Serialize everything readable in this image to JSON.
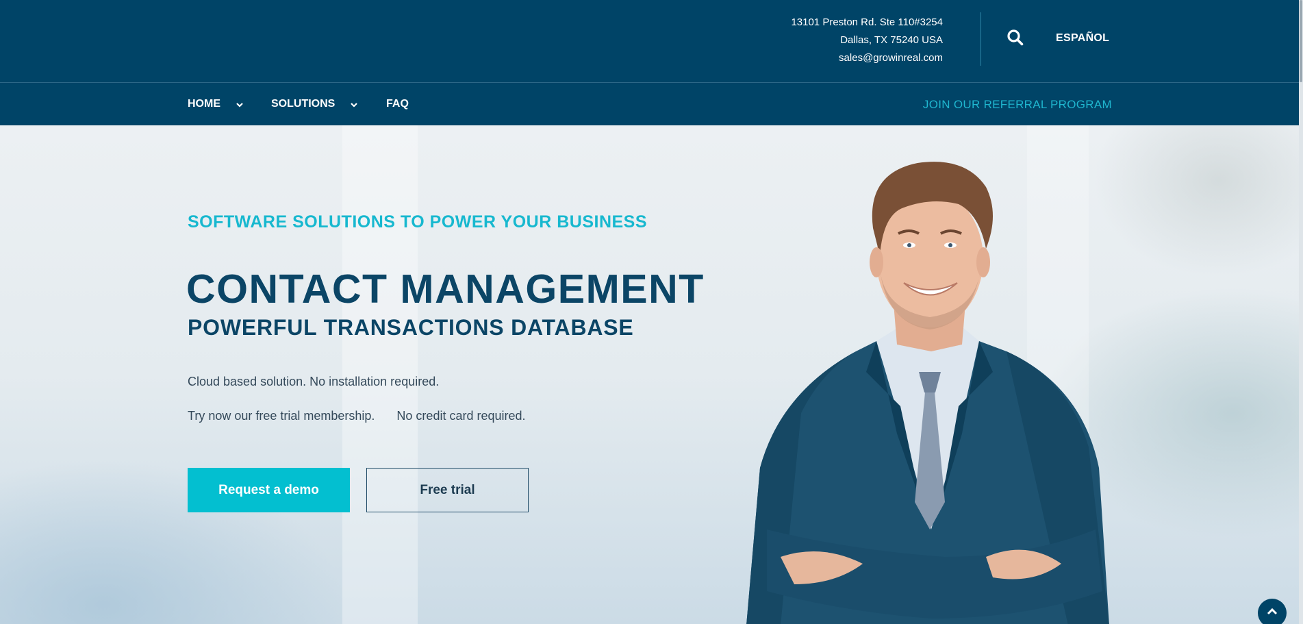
{
  "header": {
    "address_line1": "13101 Preston Rd. Ste 110#3254",
    "address_line2": "Dallas, TX 75240 USA",
    "email": "sales@growinreal.com",
    "search_icon": "search-icon",
    "language_label": "ESPAÑOL"
  },
  "nav": {
    "items": [
      {
        "label": "HOME",
        "has_dropdown": true
      },
      {
        "label": "SOLUTIONS",
        "has_dropdown": true
      },
      {
        "label": "FAQ",
        "has_dropdown": false
      }
    ],
    "referral_label": "JOIN OUR REFERRAL PROGRAM"
  },
  "hero": {
    "tagline": "SOFTWARE SOLUTIONS TO POWER YOUR BUSINESS",
    "headline": "CONTACT MANAGEMENT",
    "subheadline": "POWERFUL TRANSACTIONS DATABASE",
    "line1": "Cloud based solution. No installation required.",
    "line2_part1": "Try now our free trial membership.",
    "line2_part2": "No credit card required.",
    "demo_button": "Request a demo",
    "trial_button": "Free trial"
  },
  "colors": {
    "navy": "#004467",
    "accent": "#03BFD0",
    "heading": "#0B4566"
  },
  "icons": {
    "scroll_top": "chevron-up-icon",
    "dropdown": "chevron-down-icon"
  }
}
